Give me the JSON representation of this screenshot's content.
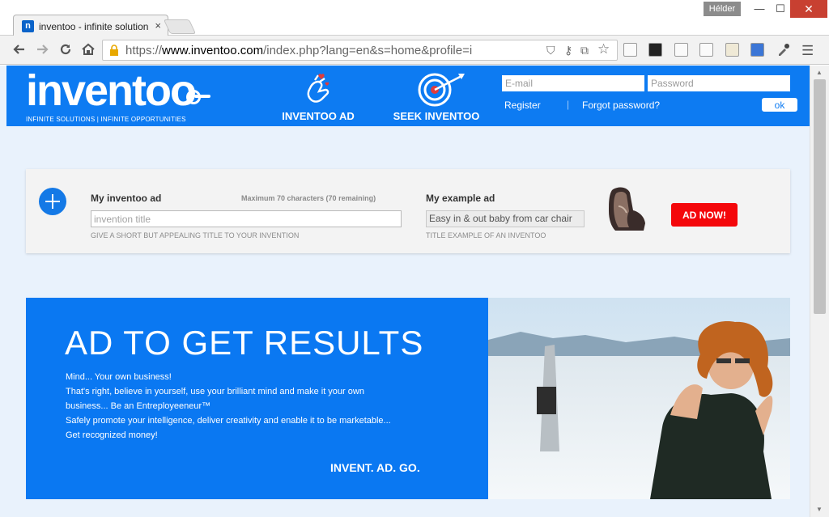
{
  "browser": {
    "tab_title": "inventoo - infinite solution",
    "tab_close": "×",
    "favicon_letter": "n",
    "user_name": "Hélder",
    "url_scheme": "https://",
    "url_host": "www.inventoo.com",
    "url_rest": "/index.php?lang=en&s=home&profile=i",
    "window_minimize": "—",
    "window_maximize": "☐",
    "window_close": "✕"
  },
  "header": {
    "logo_text": "inventoo",
    "tagline": "INFINITE SOLUTIONS | INFINITE OPPORTUNITIES",
    "nav": [
      {
        "label": "INVENTOO AD",
        "icon": "hand-heart-icon"
      },
      {
        "label": "SEEK INVENTOO",
        "icon": "target-arrow-icon"
      }
    ],
    "login": {
      "email_placeholder": "E-mail",
      "password_placeholder": "Password",
      "register": "Register",
      "separator": "|",
      "forgot": "Forgot password?",
      "ok": "ok"
    }
  },
  "ad_form": {
    "title": "My inventoo ad",
    "max_chars": "Maximum 70 characters (70 remaining)",
    "input_placeholder": "invention title",
    "hint": "GIVE A SHORT BUT APPEALING TITLE TO YOUR INVENTION",
    "example_title": "My example ad",
    "example_value": "Easy in & out baby from car chair",
    "example_hint": "TITLE EXAMPLE OF AN INVENTOO",
    "button": "AD NOW!"
  },
  "banner": {
    "headline": "AD TO GET RESULTS",
    "lines": [
      "Mind... Your own business!",
      "That's right, believe in yourself, use your brilliant mind and make it your own",
      "business... Be an Entreployeeneur™",
      "Safely promote your intelligence, deliver creativity and enable it to be marketable...",
      "Get recognized money!"
    ],
    "slogan": "INVENT. AD. GO."
  },
  "colors": {
    "brand_blue": "#0d7bf2",
    "banner_blue": "#0a78f2",
    "page_bg": "#e9f2fc",
    "cta_red": "#f4070b"
  }
}
